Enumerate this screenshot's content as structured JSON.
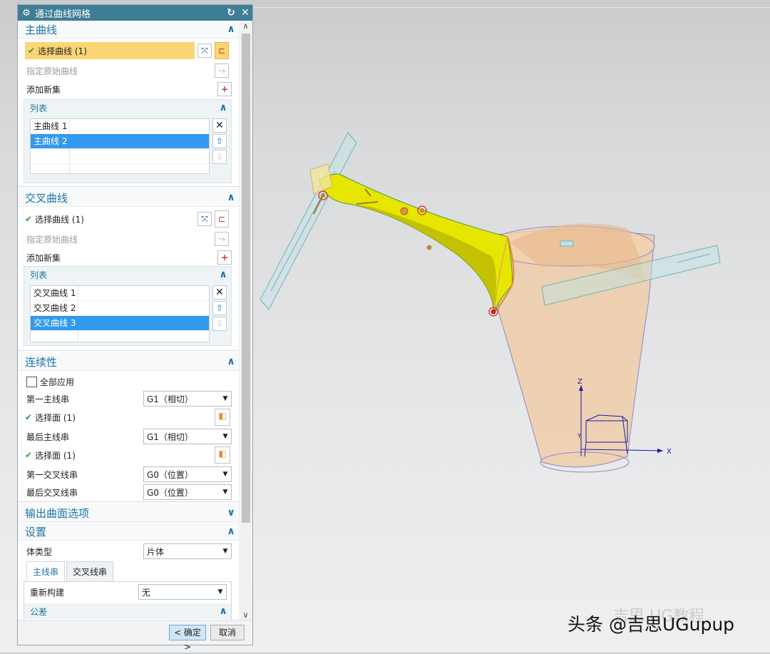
{
  "dialog": {
    "title": "通过曲线网格",
    "reset_icon": "reset-icon",
    "close_icon": "close-icon"
  },
  "main_curves": {
    "header": "主曲线",
    "select_label": "选择曲线 (1)",
    "specify_origin": "指定原始曲线",
    "add_new_set": "添加新集",
    "list_header": "列表",
    "items": [
      "主曲线 1",
      "主曲线 2"
    ],
    "selected_index": 1
  },
  "cross_curves": {
    "header": "交叉曲线",
    "select_label": "选择曲线 (1)",
    "specify_origin": "指定原始曲线",
    "add_new_set": "添加新集",
    "list_header": "列表",
    "items": [
      "交叉曲线 1",
      "交叉曲线 2",
      "交叉曲线 3"
    ],
    "selected_index": 2
  },
  "continuity": {
    "header": "连续性",
    "apply_all": "全部应用",
    "apply_all_checked": false,
    "first_primary": {
      "label": "第一主线串",
      "value": "G1（相切）"
    },
    "select_face_1": "选择面 (1)",
    "last_primary": {
      "label": "最后主线串",
      "value": "G1（相切）"
    },
    "select_face_2": "选择面 (1)",
    "first_cross": {
      "label": "第一交叉线串",
      "value": "G0（位置）"
    },
    "last_cross": {
      "label": "最后交叉线串",
      "value": "G0（位置）"
    }
  },
  "output_options": {
    "header": "输出曲面选项"
  },
  "settings": {
    "header": "设置",
    "body_type": {
      "label": "体类型",
      "value": "片体"
    },
    "tabs": [
      "主线串",
      "交叉线串"
    ],
    "active_tab": 0,
    "rebuild": {
      "label": "重新构建",
      "value": "无"
    },
    "tolerance_header": "公差"
  },
  "buttons": {
    "ok": "< 确定 >",
    "cancel": "取消"
  },
  "viewport": {
    "axis_z": "Z",
    "axis_x": "X",
    "axis_y": "Y",
    "watermark": "头条 @吉思UGupup",
    "watermark_faint": "吉思 UG教程"
  },
  "colors": {
    "title_bar": "#3e7d96",
    "accent": "#1e74a6",
    "selection_highlight": "#fbd676",
    "list_selected": "#3399ee",
    "surface_yellow": "#e6e600",
    "body_tan": "#f0c9a0"
  }
}
